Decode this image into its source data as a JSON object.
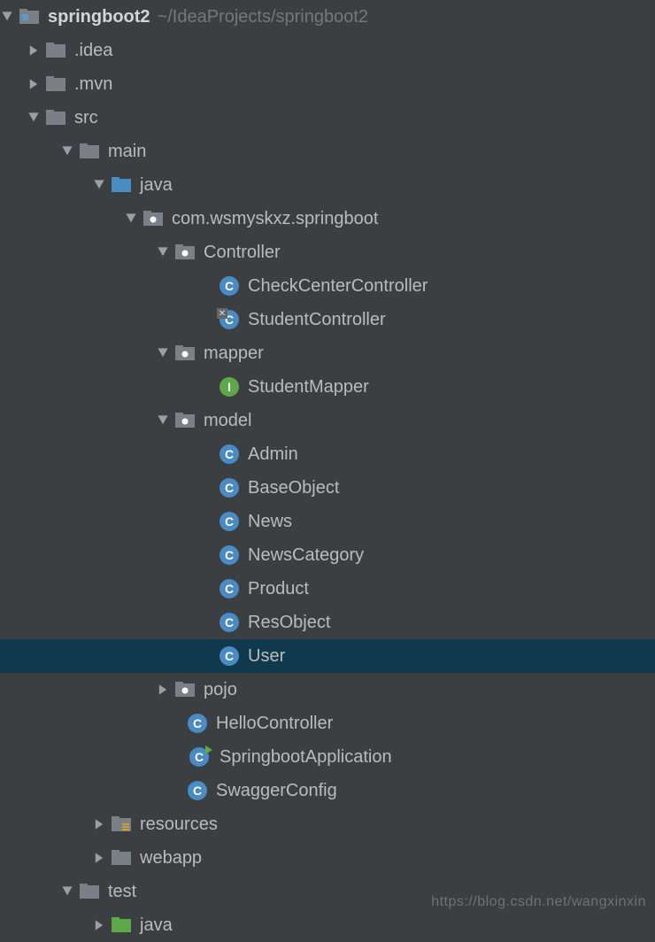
{
  "project": {
    "name": "springboot2",
    "path": "~/IdeaProjects/springboot2"
  },
  "tree": {
    "idea": ".idea",
    "mvn": ".mvn",
    "src": "src",
    "main": "main",
    "java": "java",
    "pkg": "com.wsmyskxz.springboot",
    "controller_pkg": "Controller",
    "checkcenter": "CheckCenterController",
    "studentcontroller": "StudentController",
    "mapper_pkg": "mapper",
    "studentmapper": "StudentMapper",
    "model_pkg": "model",
    "admin": "Admin",
    "baseobject": "BaseObject",
    "news": "News",
    "newscategory": "NewsCategory",
    "product": "Product",
    "resobject": "ResObject",
    "user": "User",
    "pojo": "pojo",
    "hellocontroller": "HelloController",
    "springbootapp": "SpringbootApplication",
    "swaggerconfig": "SwaggerConfig",
    "resources": "resources",
    "webapp": "webapp",
    "test": "test",
    "test_java": "java"
  },
  "badges": {
    "class": "C",
    "interface": "I"
  },
  "watermark": "https://blog.csdn.net/wangxinxin"
}
